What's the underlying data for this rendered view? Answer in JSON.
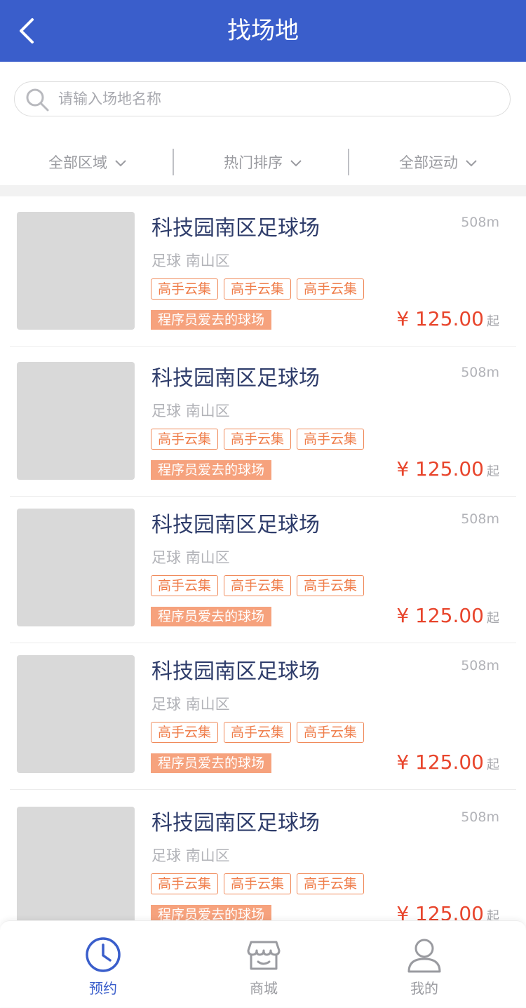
{
  "header": {
    "title": "找场地",
    "back_icon": "chevron-left-icon"
  },
  "search": {
    "placeholder": "请输入场地名称",
    "value": "",
    "icon": "search-icon"
  },
  "filters": [
    {
      "label": "全部区域",
      "icon": "chevron-down-icon"
    },
    {
      "label": "热门排序",
      "icon": "chevron-down-icon"
    },
    {
      "label": "全部运动",
      "icon": "chevron-down-icon"
    }
  ],
  "venues": [
    {
      "name": "科技园南区足球场",
      "distance": "508m",
      "sport": "足球",
      "district": "南山区",
      "tags": [
        "高手云集",
        "高手云集",
        "高手云集"
      ],
      "promo": "程序员爱去的球场",
      "price": "¥ 125.00",
      "price_suffix": "起"
    },
    {
      "name": "科技园南区足球场",
      "distance": "508m",
      "sport": "足球",
      "district": "南山区",
      "tags": [
        "高手云集",
        "高手云集",
        "高手云集"
      ],
      "promo": "程序员爱去的球场",
      "price": "¥ 125.00",
      "price_suffix": "起"
    },
    {
      "name": "科技园南区足球场",
      "distance": "508m",
      "sport": "足球",
      "district": "南山区",
      "tags": [
        "高手云集",
        "高手云集",
        "高手云集"
      ],
      "promo": "程序员爱去的球场",
      "price": "¥ 125.00",
      "price_suffix": "起"
    },
    {
      "name": "科技园南区足球场",
      "distance": "508m",
      "sport": "足球",
      "district": "南山区",
      "tags": [
        "高手云集",
        "高手云集",
        "高手云集"
      ],
      "promo": "程序员爱去的球场",
      "price": "¥ 125.00",
      "price_suffix": "起"
    },
    {
      "name": "科技园南区足球场",
      "distance": "508m",
      "sport": "足球",
      "district": "南山区",
      "tags": [
        "高手云集",
        "高手云集",
        "高手云集"
      ],
      "promo": "程序员爱去的球场",
      "price": "¥ 125.00",
      "price_suffix": "起"
    }
  ],
  "tabbar": [
    {
      "label": "预约",
      "icon": "clock-icon",
      "active": true
    },
    {
      "label": "商城",
      "icon": "store-icon",
      "active": false
    },
    {
      "label": "我的",
      "icon": "user-icon",
      "active": false
    }
  ],
  "colors": {
    "primary": "#3a5ecb",
    "price": "#e8452c",
    "tag": "#ef7d4a",
    "promo_bg": "#f6a27d",
    "title_text": "#2f3d6b"
  }
}
